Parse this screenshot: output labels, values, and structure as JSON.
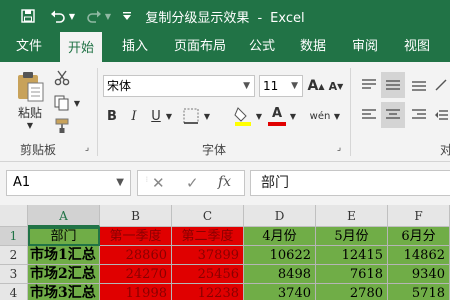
{
  "app": {
    "window_title": "复制分级显示效果",
    "separator": "-",
    "app_name": "Excel"
  },
  "quick_access": {
    "save_icon": "save-icon",
    "undo_icon": "undo-icon",
    "redo_icon": "redo-icon",
    "customize_icon": "customize-dropdown-icon"
  },
  "tabs": [
    {
      "label": "文件"
    },
    {
      "label": "开始"
    },
    {
      "label": "插入"
    },
    {
      "label": "页面布局"
    },
    {
      "label": "公式"
    },
    {
      "label": "数据"
    },
    {
      "label": "审阅"
    },
    {
      "label": "视图"
    }
  ],
  "active_tab": "开始",
  "ribbon": {
    "clipboard": {
      "paste_label": "粘贴",
      "group_label": "剪贴板"
    },
    "font": {
      "font_name": "宋体",
      "font_size": "11",
      "bold": "B",
      "italic": "I",
      "underline": "U",
      "grow": "A",
      "shrink": "A",
      "font_color_glyph": "A",
      "phonetic": "wén",
      "group_label": "字体"
    },
    "alignment": {
      "group_label": "对"
    }
  },
  "formula_bar": {
    "name_box": "A1",
    "cancel": "✕",
    "enter": "✓",
    "fx": "fx",
    "value": "部门"
  },
  "grid": {
    "columns": [
      "A",
      "B",
      "C",
      "D",
      "E",
      "F"
    ],
    "rows": [
      "1",
      "2",
      "3",
      "4"
    ],
    "cells": [
      [
        "部门",
        "第一季度",
        "第二季度",
        "4月份",
        "5月份",
        "6月分"
      ],
      [
        "市场1汇总",
        "28860",
        "37899",
        "10622",
        "12415",
        "14862"
      ],
      [
        "市场2汇总",
        "24270",
        "25456",
        "8498",
        "7618",
        "9340"
      ],
      [
        "市场3汇总",
        "11998",
        "12238",
        "3740",
        "2780",
        "5718"
      ]
    ]
  },
  "colors": {
    "accent": "#217346",
    "green_fill": "#70ad47",
    "red_fill": "#e00000",
    "red_text": "#8a0000"
  }
}
